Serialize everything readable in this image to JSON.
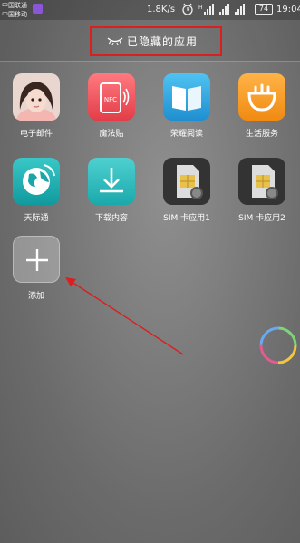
{
  "status_bar": {
    "carrier1": "中国联通",
    "carrier2": "中国移动",
    "net_speed": "1.8K/s",
    "battery": "74",
    "time": "19:04",
    "icons": [
      "app-notification-icon",
      "alarm-icon",
      "signal-icon",
      "signal-icon",
      "signal-icon",
      "battery-icon"
    ]
  },
  "header": {
    "title": "已隐藏的应用",
    "icon": "closed-eye-icon",
    "highlight_color": "#d91f1f"
  },
  "apps": [
    {
      "label": "电子邮件",
      "icon": "email-avatar-icon"
    },
    {
      "label": "魔法贴",
      "icon": "nfc-icon"
    },
    {
      "label": "荣耀阅读",
      "icon": "book-icon"
    },
    {
      "label": "生活服务",
      "icon": "smile-service-icon"
    },
    {
      "label": "天际通",
      "icon": "globe-icon"
    },
    {
      "label": "下载内容",
      "icon": "download-icon"
    },
    {
      "label": "SIM 卡应用1",
      "icon": "sim-card-icon"
    },
    {
      "label": "SIM 卡应用2",
      "icon": "sim-card-icon"
    }
  ],
  "add_button": {
    "label": "添加",
    "icon": "plus-icon"
  },
  "annotation": {
    "arrow_color": "#d91f1f"
  }
}
